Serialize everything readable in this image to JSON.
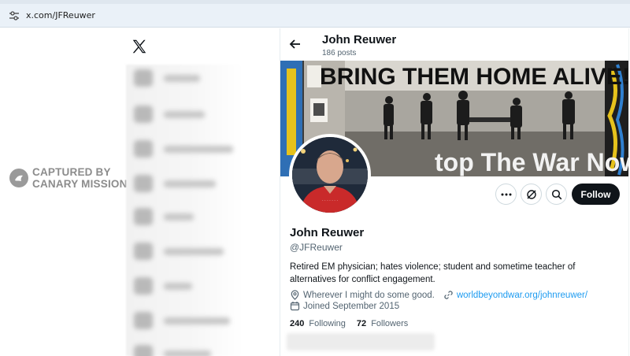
{
  "browser": {
    "url": "x.com/JFReuwer",
    "site_icon": "tune-icon"
  },
  "watermark": {
    "line1": "CAPTURED BY",
    "line2": "CANARY MISSION"
  },
  "nav": {
    "logo": "x-logo-icon",
    "blurred_items": 9
  },
  "header": {
    "name": "John Reuwer",
    "posts": "186 posts",
    "back_icon": "arrow-left-icon"
  },
  "banner": {
    "headline": "BRING THEM HOME ALIVE!",
    "sub": "top The War Now!"
  },
  "actions": {
    "more_icon": "more-icon",
    "subscribe_icon": "grok-icon",
    "search_icon": "search-icon",
    "follow_label": "Follow"
  },
  "profile": {
    "name": "John Reuwer",
    "handle": "@JFReuwer",
    "bio": "Retired EM physician; hates violence; student and sometime teacher of alternatives for conflict engagement.",
    "location": "Wherever I might do some good.",
    "website": "worldbeyondwar.org/johnreuwer/",
    "joined": "Joined September 2015",
    "following_count": "240",
    "following_label": "Following",
    "followers_count": "72",
    "followers_label": "Followers"
  },
  "colors": {
    "accent": "#1d9bf0",
    "follow_bg": "#0f1419",
    "muted": "#536471"
  }
}
